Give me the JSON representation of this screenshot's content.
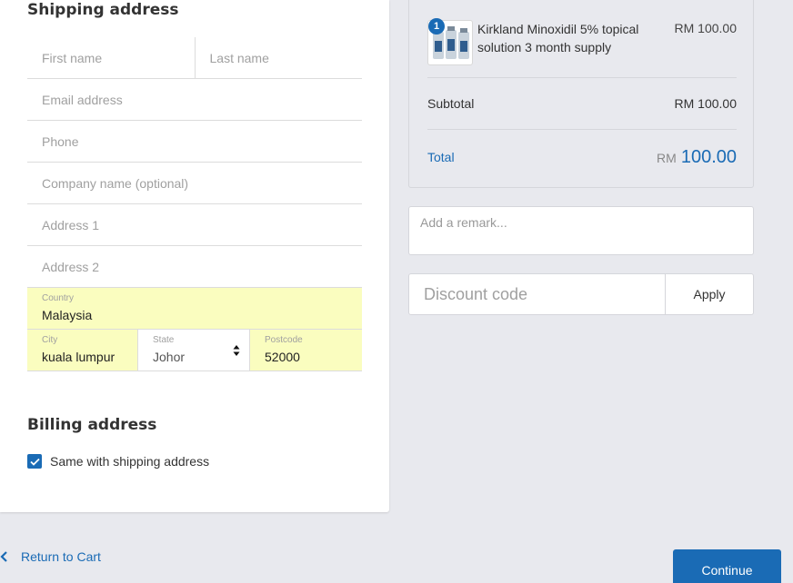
{
  "shipping": {
    "title": "Shipping address",
    "first_name_placeholder": "First name",
    "last_name_placeholder": "Last name",
    "email_placeholder": "Email address",
    "phone_placeholder": "Phone",
    "company_placeholder": "Company name (optional)",
    "address1_placeholder": "Address 1",
    "address2_placeholder": "Address 2",
    "country_label": "Country",
    "country_value": "Malaysia",
    "city_label": "City",
    "city_value": "kuala lumpur",
    "state_label": "State",
    "state_value": "Johor",
    "postcode_label": "Postcode",
    "postcode_value": "52000"
  },
  "billing": {
    "title": "Billing address",
    "same_label": "Same with shipping address",
    "same_checked": true
  },
  "summary": {
    "product": {
      "quantity": "1",
      "name": "Kirkland Minoxidil 5% topical solution 3 month supply",
      "price": "RM 100.00"
    },
    "subtotal_label": "Subtotal",
    "subtotal_value": "RM 100.00",
    "total_label": "Total",
    "total_currency": "RM",
    "total_value": "100.00"
  },
  "remark_placeholder": "Add a remark...",
  "discount": {
    "placeholder": "Discount code",
    "apply_label": "Apply"
  },
  "nav": {
    "return_label": "Return to Cart",
    "continue_label": "Continue"
  },
  "colors": {
    "accent": "#1a6bb5",
    "autofill": "#fafdbf",
    "background": "#e8e9ee"
  }
}
